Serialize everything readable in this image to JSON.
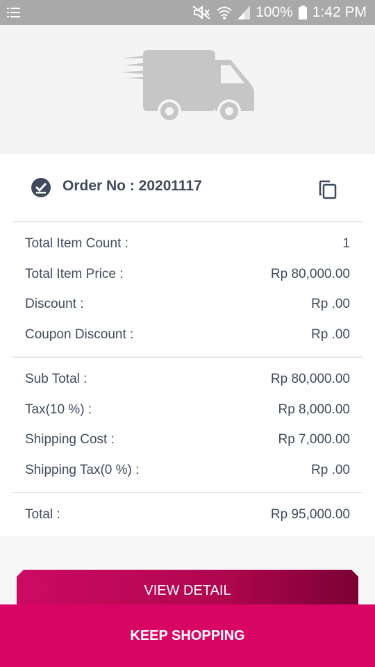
{
  "status_bar": {
    "battery": "100%",
    "time": "1:42 PM"
  },
  "order": {
    "label": "Order No : 20201117"
  },
  "summary": {
    "item_rows": [
      {
        "label": "Total Item Count :",
        "value": "1"
      },
      {
        "label": "Total Item Price :",
        "value": "Rp 80,000.00"
      },
      {
        "label": "Discount :",
        "value": "Rp .00"
      },
      {
        "label": "Coupon Discount :",
        "value": "Rp .00"
      }
    ],
    "subtotal_rows": [
      {
        "label": "Sub Total :",
        "value": "Rp 80,000.00"
      },
      {
        "label": "Tax(10 %) :",
        "value": "Rp 8,000.00"
      },
      {
        "label": "Shipping Cost :",
        "value": "Rp 7,000.00"
      },
      {
        "label": "Shipping Tax(0 %) :",
        "value": "Rp .00"
      }
    ],
    "total": {
      "label": "Total :",
      "value": "Rp 95,000.00"
    }
  },
  "buttons": {
    "view_detail": "VIEW DETAIL",
    "keep_shopping": "KEEP SHOPPING"
  },
  "colors": {
    "primary": "#d90565",
    "text": "#3f4b5c",
    "icon_gray": "#c6c6c6"
  },
  "icons": [
    "menu-icon",
    "mute-icon",
    "wifi-icon",
    "signal-icon",
    "battery-icon",
    "truck-icon",
    "check-circle-icon",
    "copy-icon"
  ]
}
